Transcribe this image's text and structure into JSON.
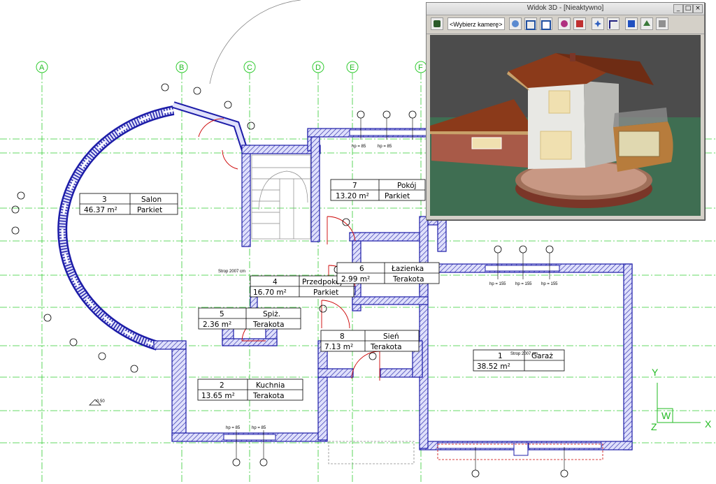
{
  "grid_axes": [
    "A",
    "B",
    "C",
    "D",
    "E",
    "F"
  ],
  "rooms": [
    {
      "number": "3",
      "name": "Salon",
      "area": "46.37 m²",
      "floor": "Parkiet"
    },
    {
      "number": "7",
      "name": "Pokój",
      "area": "13.20 m²",
      "floor": "Parkiet"
    },
    {
      "number": "4",
      "name": "Przedpokój",
      "area": "16.70 m²",
      "floor": "Parkiet"
    },
    {
      "number": "6",
      "name": "Łazienka",
      "area": "2.99 m²",
      "floor": "Terakota"
    },
    {
      "number": "5",
      "name": "Spiż.",
      "area": "2.36 m²",
      "floor": "Terakota"
    },
    {
      "number": "8",
      "name": "Sień",
      "area": "7.13 m²",
      "floor": "Terakota"
    },
    {
      "number": "2",
      "name": "Kuchnia",
      "area": "13.65 m²",
      "floor": "Terakota"
    },
    {
      "number": "1",
      "name": "Garaż",
      "area": "38.52 m²",
      "floor": ""
    }
  ],
  "window_tags": [
    "hp = 85",
    "hp = 85",
    "hp = 85",
    "hp = 85",
    "hp = 155",
    "hp = 155",
    "hp = 155"
  ],
  "level_mark": "-0.50",
  "ceiling_notes": [
    "Strop 2007 cm",
    "Strop 2007 cm"
  ],
  "ucs": {
    "x_label": "X",
    "y_label": "Y",
    "z_label": "Z",
    "w_label": "W"
  },
  "window3d": {
    "title": "Widok 3D - [Nieaktywno]",
    "camera_placeholder": "<Wybierz kamerę>",
    "toolbar_icons": [
      "camera-add-icon",
      "view-front-icon",
      "view-top-icon",
      "render-icon",
      "wall-icon",
      "pan-icon",
      "rotate-icon",
      "zoom-icon",
      "tree-icon",
      "3d-icon"
    ],
    "colors": {
      "sky": "#4c4c4c",
      "ground": "#3f6e52",
      "roof": "#8b3a1a",
      "brick": "#a85a48",
      "plaster": "#e8e8e4",
      "wood": "#b77c3c"
    }
  },
  "colors": {
    "wall": "#1c1ca8",
    "grid": "#22bb22",
    "hatch": "#8a8ae0"
  }
}
